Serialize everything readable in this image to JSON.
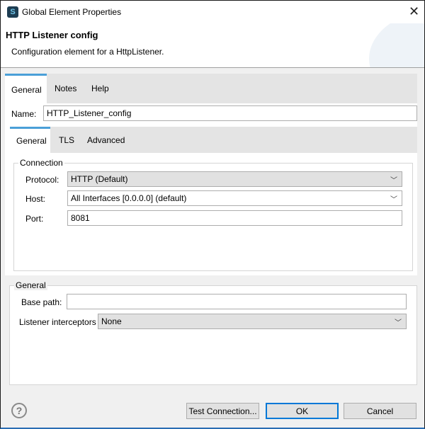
{
  "window": {
    "title": "Global Element Properties",
    "close_icon": "close-icon",
    "app_icon": "mule-studio-icon"
  },
  "header": {
    "title": "HTTP Listener config",
    "subtitle": "Configuration element for a HttpListener."
  },
  "outer_tabs": [
    {
      "label": "General",
      "active": true
    },
    {
      "label": "Notes"
    },
    {
      "label": "Help"
    }
  ],
  "name": {
    "label": "Name:",
    "value": "HTTP_Listener_config"
  },
  "inner_tabs": [
    {
      "label": "General",
      "active": true
    },
    {
      "label": "TLS"
    },
    {
      "label": "Advanced"
    }
  ],
  "connection": {
    "legend": "Connection",
    "protocol": {
      "label": "Protocol:",
      "value": "HTTP (Default)"
    },
    "host": {
      "label": "Host:",
      "value": "All Interfaces [0.0.0.0] (default)"
    },
    "port": {
      "label": "Port:",
      "value": "8081"
    }
  },
  "general": {
    "legend": "General",
    "base_path": {
      "label": "Base path:",
      "value": ""
    },
    "interceptors": {
      "label": "Listener interceptors",
      "value": "None"
    }
  },
  "buttons": {
    "test": "Test Connection...",
    "ok": "OK",
    "cancel": "Cancel",
    "help_icon": "help-icon"
  },
  "colors": {
    "accent": "#4a9fd8",
    "default_button_border": "#0078d7"
  }
}
